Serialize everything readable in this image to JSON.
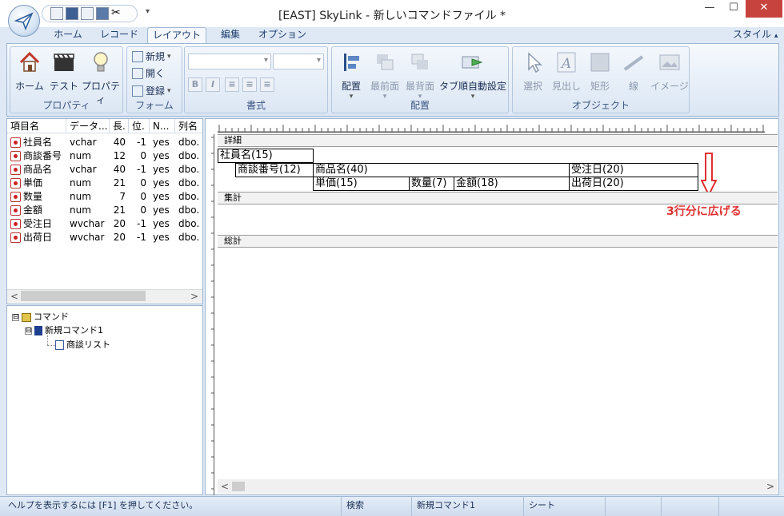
{
  "window": {
    "title": "[EAST] SkyLink - 新しいコマンドファイル *",
    "min": "—",
    "max": "☐",
    "close": "✕"
  },
  "qat": {
    "dropdown": "▾"
  },
  "tabs": [
    "ホーム",
    "レコード",
    "レイアウト",
    "編集",
    "オプション"
  ],
  "active_tab": "レイアウト",
  "style_menu": "スタイル",
  "style_menu_arrow": "▴",
  "ribbon": {
    "groups": {
      "property": {
        "label": "プロパティ",
        "buttons": [
          "ホーム",
          "テスト",
          "プロパティ"
        ]
      },
      "form": {
        "label": "フォーム",
        "buttons": [
          "新規",
          "開く",
          "登録"
        ],
        "arrow": "▾"
      },
      "format": {
        "label": "書式",
        "buttons": [
          "B",
          "I",
          "≡",
          "≡",
          "≡"
        ]
      },
      "arrange": {
        "label": "配置",
        "buttons": [
          "配置",
          "最前面",
          "最背面",
          "タブ順自動設定"
        ],
        "arrow": "▾"
      },
      "object": {
        "label": "オブジェクト",
        "buttons": [
          "選択",
          "見出し",
          "矩形",
          "線",
          "イメージ"
        ]
      }
    }
  },
  "field_list": {
    "columns": [
      "項目名",
      "データ...",
      "長.",
      "位.",
      "N...",
      "列名"
    ],
    "rows": [
      [
        "社員名",
        "vchar",
        "40",
        "-1",
        "yes",
        "dbo."
      ],
      [
        "商談番号",
        "num",
        "12",
        "0",
        "yes",
        "dbo."
      ],
      [
        "商品名",
        "vchar",
        "40",
        "-1",
        "yes",
        "dbo."
      ],
      [
        "単価",
        "num",
        "21",
        "0",
        "yes",
        "dbo."
      ],
      [
        "数量",
        "num",
        "7",
        "0",
        "yes",
        "dbo."
      ],
      [
        "金額",
        "num",
        "21",
        "0",
        "yes",
        "dbo."
      ],
      [
        "受注日",
        "wvchar",
        "20",
        "-1",
        "yes",
        "dbo."
      ],
      [
        "出荷日",
        "wvchar",
        "20",
        "-1",
        "yes",
        "dbo."
      ]
    ],
    "scroll_left": "<",
    "scroll_right": ">"
  },
  "tree": {
    "root": "コマンド",
    "child": "新規コマンド1",
    "leaf": "商談リスト",
    "expand": "⊟"
  },
  "designer": {
    "bands": [
      "詳細",
      "集計",
      "総計"
    ],
    "cells": [
      "社員名(15)",
      "商談番号(12)",
      "商品名(40)",
      "受注日(20)",
      "単価(15)",
      "数量(7)",
      "金額(18)",
      "出荷日(20)"
    ],
    "annotation": "3行分に広げる",
    "annotation_color": "#e03030",
    "scroll_left": "<",
    "scroll_right": ">"
  },
  "status": {
    "help": "ヘルプを表示するには [F1] を押してください。",
    "search": "検索",
    "command": "新規コマンド1",
    "sheet": "シート"
  }
}
